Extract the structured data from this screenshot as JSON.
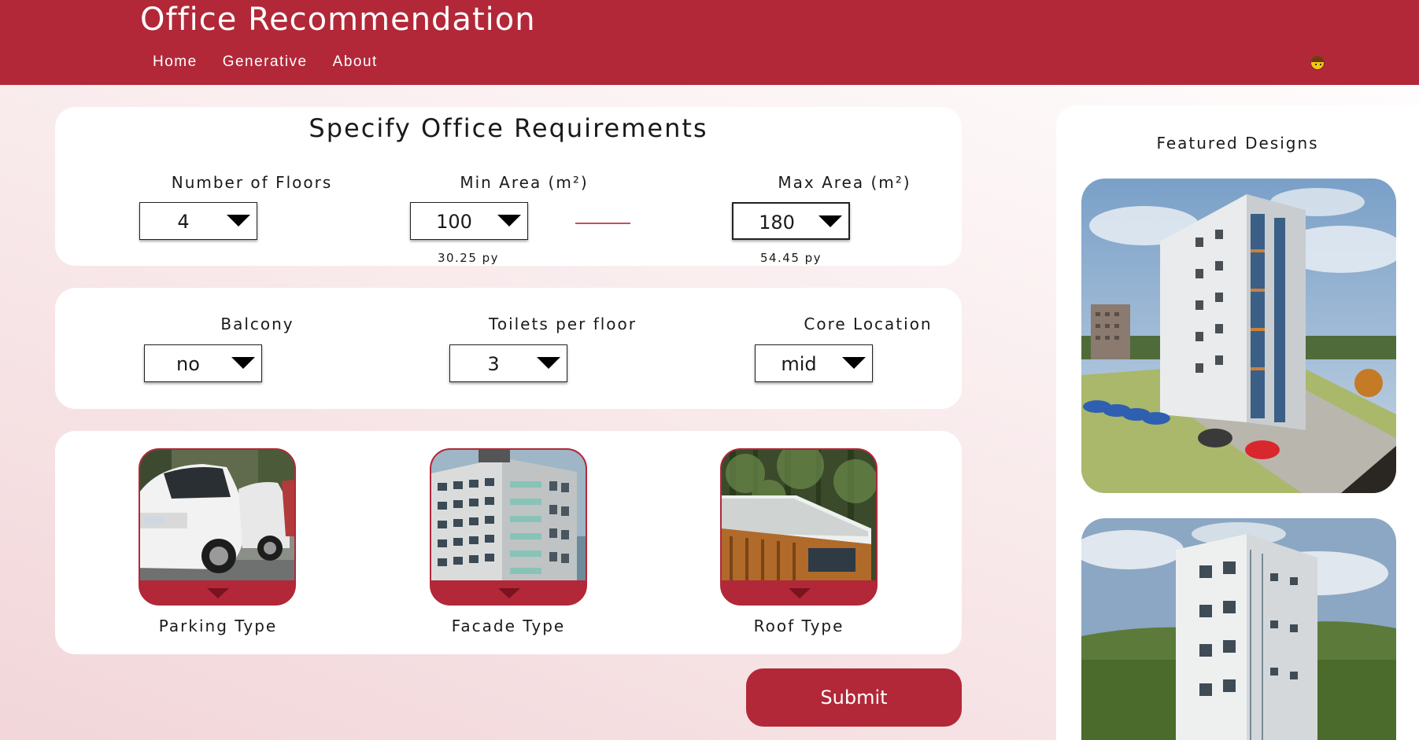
{
  "app": {
    "title": "Office Recommendation",
    "nav": [
      "Home",
      "Generative",
      "About"
    ],
    "avatar_icon": "user-avatar-icon",
    "brand_color": "#b22838"
  },
  "requirements": {
    "title": "Specify Office Requirements",
    "floors": {
      "label": "Number of Floors",
      "value": "4"
    },
    "min_area": {
      "label": "Min Area (m²)",
      "value": "100",
      "py": "30.25 py"
    },
    "max_area": {
      "label": "Max Area (m²)",
      "value": "180",
      "py": "54.45 py"
    }
  },
  "options": {
    "balcony": {
      "label": "Balcony",
      "value": "no"
    },
    "toilets": {
      "label": "Toilets per floor",
      "value": "3"
    },
    "core": {
      "label": "Core Location",
      "value": "mid"
    }
  },
  "types": {
    "parking": {
      "label": "Parking Type"
    },
    "facade": {
      "label": "Facade Type"
    },
    "roof": {
      "label": "Roof Type"
    }
  },
  "submit_label": "Submit",
  "featured": {
    "title": "Featured Designs"
  }
}
